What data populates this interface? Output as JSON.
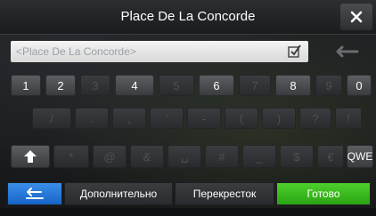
{
  "title": "Place De La Concorde",
  "search": {
    "placeholder": "<Place De La Concorde>"
  },
  "keyboard": {
    "row1": [
      "1",
      "2",
      "3",
      "4",
      "5",
      "6",
      "7",
      "8",
      "9",
      "0"
    ],
    "row1_enabled": [
      true,
      true,
      false,
      true,
      false,
      true,
      false,
      true,
      false,
      true
    ],
    "row2": [
      "/",
      ".",
      ",",
      "'",
      "-",
      "(",
      ")",
      "?",
      "!"
    ],
    "row3": [
      "*",
      "@",
      "&",
      "␣",
      "#",
      "_",
      "$",
      "€"
    ],
    "layout_switch": "QWE"
  },
  "bottom": {
    "more": "Дополнительно",
    "crossing": "Перекресток",
    "done": "Готово"
  },
  "colors": {
    "back_button": "#1f6fd6",
    "done_button": "#36b81c"
  }
}
